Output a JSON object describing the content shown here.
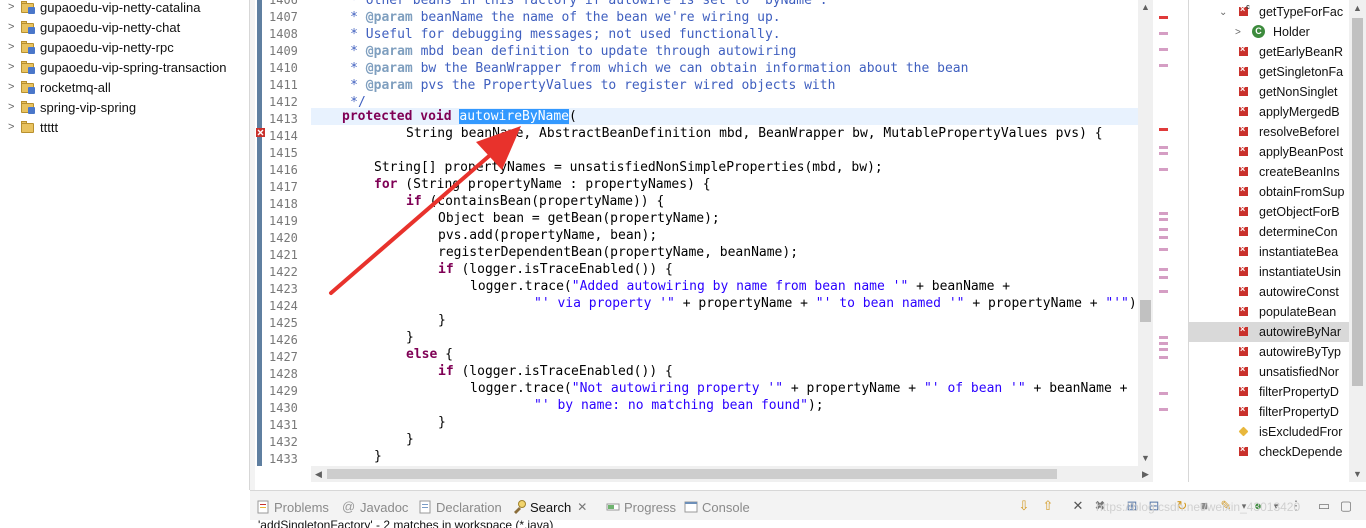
{
  "project_tree": {
    "items": [
      {
        "label": "gupaoedu-vip-netty-catalina"
      },
      {
        "label": "gupaoedu-vip-netty-chat"
      },
      {
        "label": "gupaoedu-vip-netty-rpc"
      },
      {
        "label": "gupaoedu-vip-spring-transaction"
      },
      {
        "label": "rocketmq-all"
      },
      {
        "label": "spring-vip-spring"
      },
      {
        "label": "ttttt"
      }
    ]
  },
  "editor": {
    "line_numbers": [
      "1406",
      "1407",
      "1408",
      "1409",
      "1410",
      "1411",
      "1412",
      "1413",
      "1414",
      "1415",
      "1416",
      "1417",
      "1418",
      "1419",
      "1420",
      "1421",
      "1422",
      "1423",
      "1424",
      "1425",
      "1426",
      "1427",
      "1428",
      "1429",
      "1430",
      "1431",
      "1432",
      "1433"
    ],
    "code": {
      "l1406": "     * other beans in this factory if autowire is set to \"byName\".",
      "l1407a": "     * ",
      "l1407t": "@param",
      "l1407b": " beanName the name of the bean we're wiring up.",
      "l1408": "     * Useful for debugging messages; not used functionally.",
      "l1409a": "     * ",
      "l1409t": "@param",
      "l1409b": " mbd bean definition to update through autowiring",
      "l1410a": "     * ",
      "l1410t": "@param",
      "l1410b": " bw the BeanWrapper from which we can obtain information about the bean",
      "l1411a": "     * ",
      "l1411t": "@param",
      "l1411b": " pvs the PropertyValues to register wired objects with",
      "l1412": "     */",
      "l1413_kw1": "protected",
      "l1413_kw2": "void",
      "l1413_method": "autowireByName",
      "l1413_paren": "(",
      "l1414": "String beanName, AbstractBeanDefinition mbd, BeanWrapper bw, MutablePropertyValues pvs) {",
      "l1416": "String[] propertyNames = unsatisfiedNonSimpleProperties(mbd, bw);",
      "l1417_kw": "for",
      "l1417": " (String propertyName : propertyNames) {",
      "l1418_kw": "if",
      "l1418": " (containsBean(propertyName)) {",
      "l1419": "Object bean = getBean(propertyName);",
      "l1420": "pvs.add(propertyName, bean);",
      "l1421": "registerDependentBean(propertyName, beanName);",
      "l1422_kw": "if",
      "l1422": " (logger.isTraceEnabled()) {",
      "l1423a": "logger.trace(",
      "l1423s": "\"Added autowiring by name from bean name '\"",
      "l1423b": " + beanName +",
      "l1424s1": "\"' via property '\"",
      "l1424b": " + propertyName + ",
      "l1424s2": "\"' to bean named '\"",
      "l1424c": " + propertyName + ",
      "l1424s3": "\"'\"",
      "l1424d": ");",
      "l1425": "}",
      "l1426": "}",
      "l1427_kw": "else",
      "l1427": " {",
      "l1428_kw": "if",
      "l1428": " (logger.isTraceEnabled()) {",
      "l1429a": "logger.trace(",
      "l1429s1": "\"Not autowiring property '\"",
      "l1429b": " + propertyName + ",
      "l1429s2": "\"' of bean '\"",
      "l1429c": " + beanName +",
      "l1430s": "\"' by name: no matching bean found\"",
      "l1430b": ");",
      "l1431": "}",
      "l1432": "}",
      "l1433": "}"
    }
  },
  "outline": {
    "items": [
      {
        "label": "getTypeForFac"
      },
      {
        "label": "Holder"
      },
      {
        "label": "getEarlyBeanR"
      },
      {
        "label": "getSingletonFa"
      },
      {
        "label": "getNonSinglet"
      },
      {
        "label": "applyMergedB"
      },
      {
        "label": "resolveBeforeI"
      },
      {
        "label": "applyBeanPost"
      },
      {
        "label": "createBeanIns"
      },
      {
        "label": "obtainFromSup"
      },
      {
        "label": "getObjectForB"
      },
      {
        "label": "determineCon"
      },
      {
        "label": "instantiateBea"
      },
      {
        "label": "instantiateUsin"
      },
      {
        "label": "autowireConst"
      },
      {
        "label": "populateBean"
      },
      {
        "label": "autowireByNar"
      },
      {
        "label": "autowireByTyp"
      },
      {
        "label": "unsatisfiedNor"
      },
      {
        "label": "filterPropertyD"
      },
      {
        "label": "filterPropertyD"
      },
      {
        "label": "isExcludedFror"
      },
      {
        "label": "checkDepende"
      }
    ]
  },
  "bottom_tabs": {
    "problems": "Problems",
    "javadoc": "Javadoc",
    "declaration": "Declaration",
    "search": "Search",
    "progress": "Progress",
    "console": "Console"
  },
  "search_summary": "'addSingletonFactory' - 2 matches in workspace (*.java)",
  "watermark": "https://blog.csdn.net/weixin_43013420",
  "colors": {
    "keyword": "#7f0055",
    "string": "#2a00ff",
    "javadoc": "#3f5fbf",
    "selection": "#3399ff",
    "annotation_arrow": "#e8322c"
  }
}
